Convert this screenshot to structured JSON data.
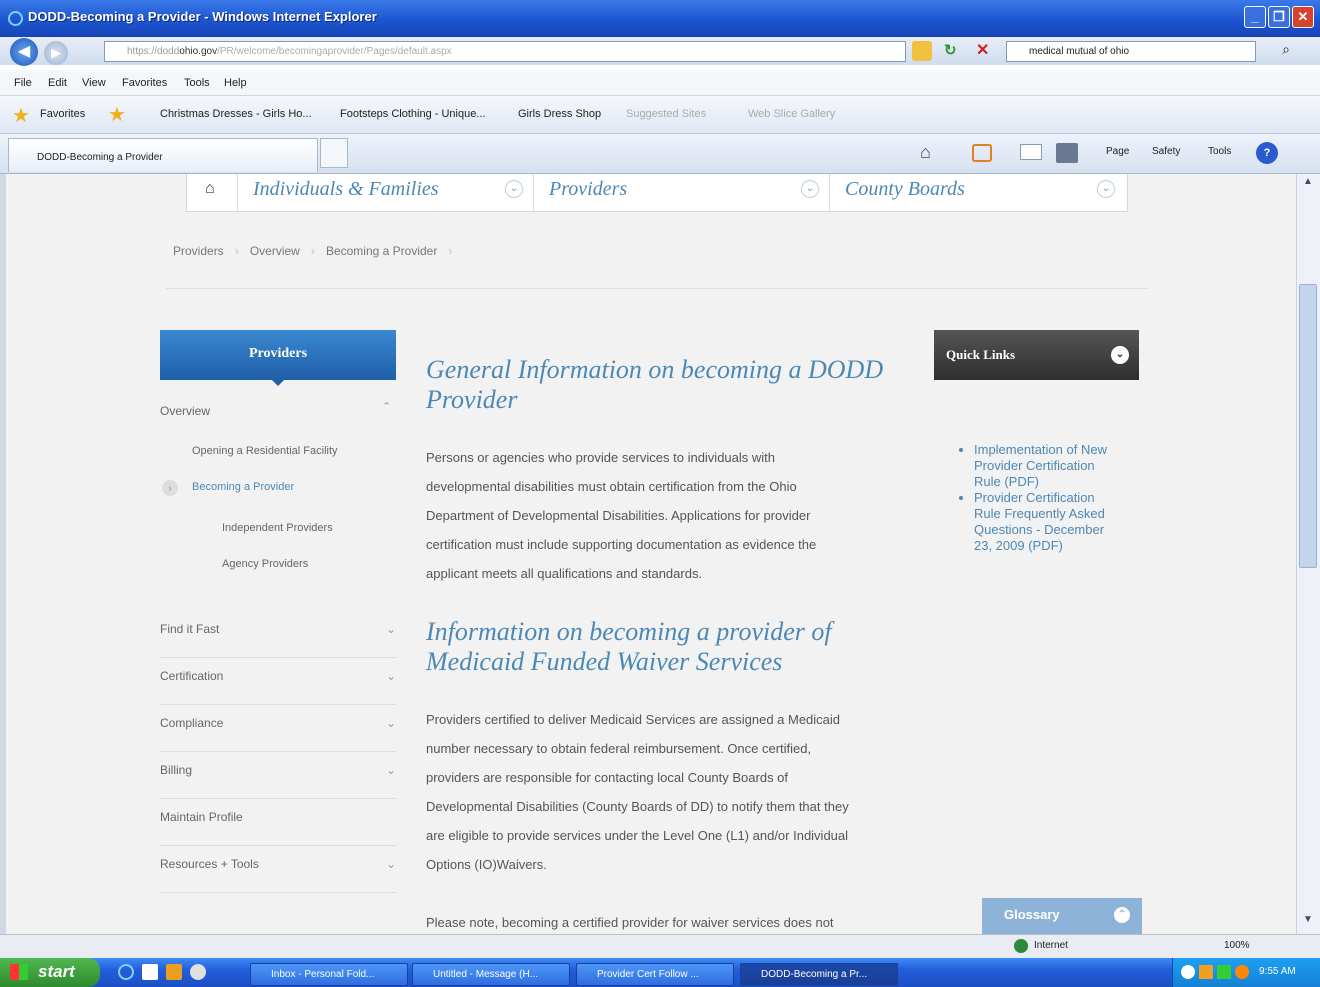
{
  "window": {
    "title": "DODD-Becoming a Provider - Windows Internet Explorer"
  },
  "address": {
    "url_prefix": "https://dodd",
    "url_domain": "ohio.gov",
    "url_rest": "/PR/welcome/becomingaprovider/Pages/default.aspx",
    "search_value": "medical mutual of ohio"
  },
  "menu": [
    "File",
    "Edit",
    "View",
    "Favorites",
    "Tools",
    "Help"
  ],
  "favorites": {
    "label": "Favorites",
    "items": [
      "Christmas Dresses - Girls Ho...",
      "Footsteps Clothing - Unique...",
      "Girls Dress Shop",
      "Suggested Sites",
      "Web Slice Gallery"
    ]
  },
  "tab": {
    "label": "DODD-Becoming a Provider"
  },
  "command_bar": {
    "page": "Page",
    "safety": "Safety",
    "tools": "Tools"
  },
  "site_nav": {
    "items": [
      "Individuals & Families",
      "Providers",
      "County Boards"
    ]
  },
  "breadcrumb": [
    "Providers",
    "Overview",
    "Becoming a Provider"
  ],
  "sidebar": {
    "header": "Providers",
    "overview": "Overview",
    "sub": [
      "Opening a Residential Facility",
      "Becoming a Provider",
      "Independent Providers",
      "Agency Providers"
    ],
    "sections": [
      "Find it Fast",
      "Certification",
      "Compliance",
      "Billing",
      "Maintain Profile",
      "Resources + Tools"
    ]
  },
  "main": {
    "heading1": [
      "General Information on becoming a DODD",
      "Provider"
    ],
    "para1": [
      "Persons or agencies who provide services to individuals with",
      "developmental disabilities must obtain certification from the Ohio",
      "Department of Developmental Disabilities.  Applications for provider",
      "certification must include supporting documentation as evidence the",
      "applicant meets all qualifications and standards."
    ],
    "heading2": [
      "Information on becoming a provider of",
      "Medicaid Funded Waiver Services"
    ],
    "para2": [
      "Providers certified to deliver Medicaid Services are assigned a Medicaid",
      "number necessary to obtain federal reimbursement. Once certified,",
      "providers are responsible for contacting local County Boards of",
      "Developmental Disabilities (County Boards of DD) to notify them that they",
      "are eligible to provide services under the Level One (L1) and/or Individual",
      "Options (IO)Waivers."
    ],
    "para3": "Please note, becoming a certified provider for waiver services does not"
  },
  "quick_links": {
    "title": "Quick Links",
    "links": [
      {
        "lines": [
          "Implementation of New",
          "Provider Certification",
          "Rule (PDF)"
        ]
      },
      {
        "lines": [
          "Provider Certification",
          "Rule Frequently Asked",
          "Questions - December",
          "23, 2009 (PDF)"
        ]
      }
    ]
  },
  "glossary": "Glossary",
  "status": {
    "zone": "Internet",
    "zoom": "100%"
  },
  "taskbar": {
    "start": "start",
    "buttons": [
      "Inbox - Personal Fold...",
      "Untitled - Message (H...",
      "Provider Cert Follow ...",
      "DODD-Becoming a Pr..."
    ],
    "time": "9:55 AM"
  },
  "colors": {
    "accent": "#4c88b4",
    "sidebar_header": "#2a6ab0",
    "quicklinks_bg": "#3a3a3a"
  }
}
